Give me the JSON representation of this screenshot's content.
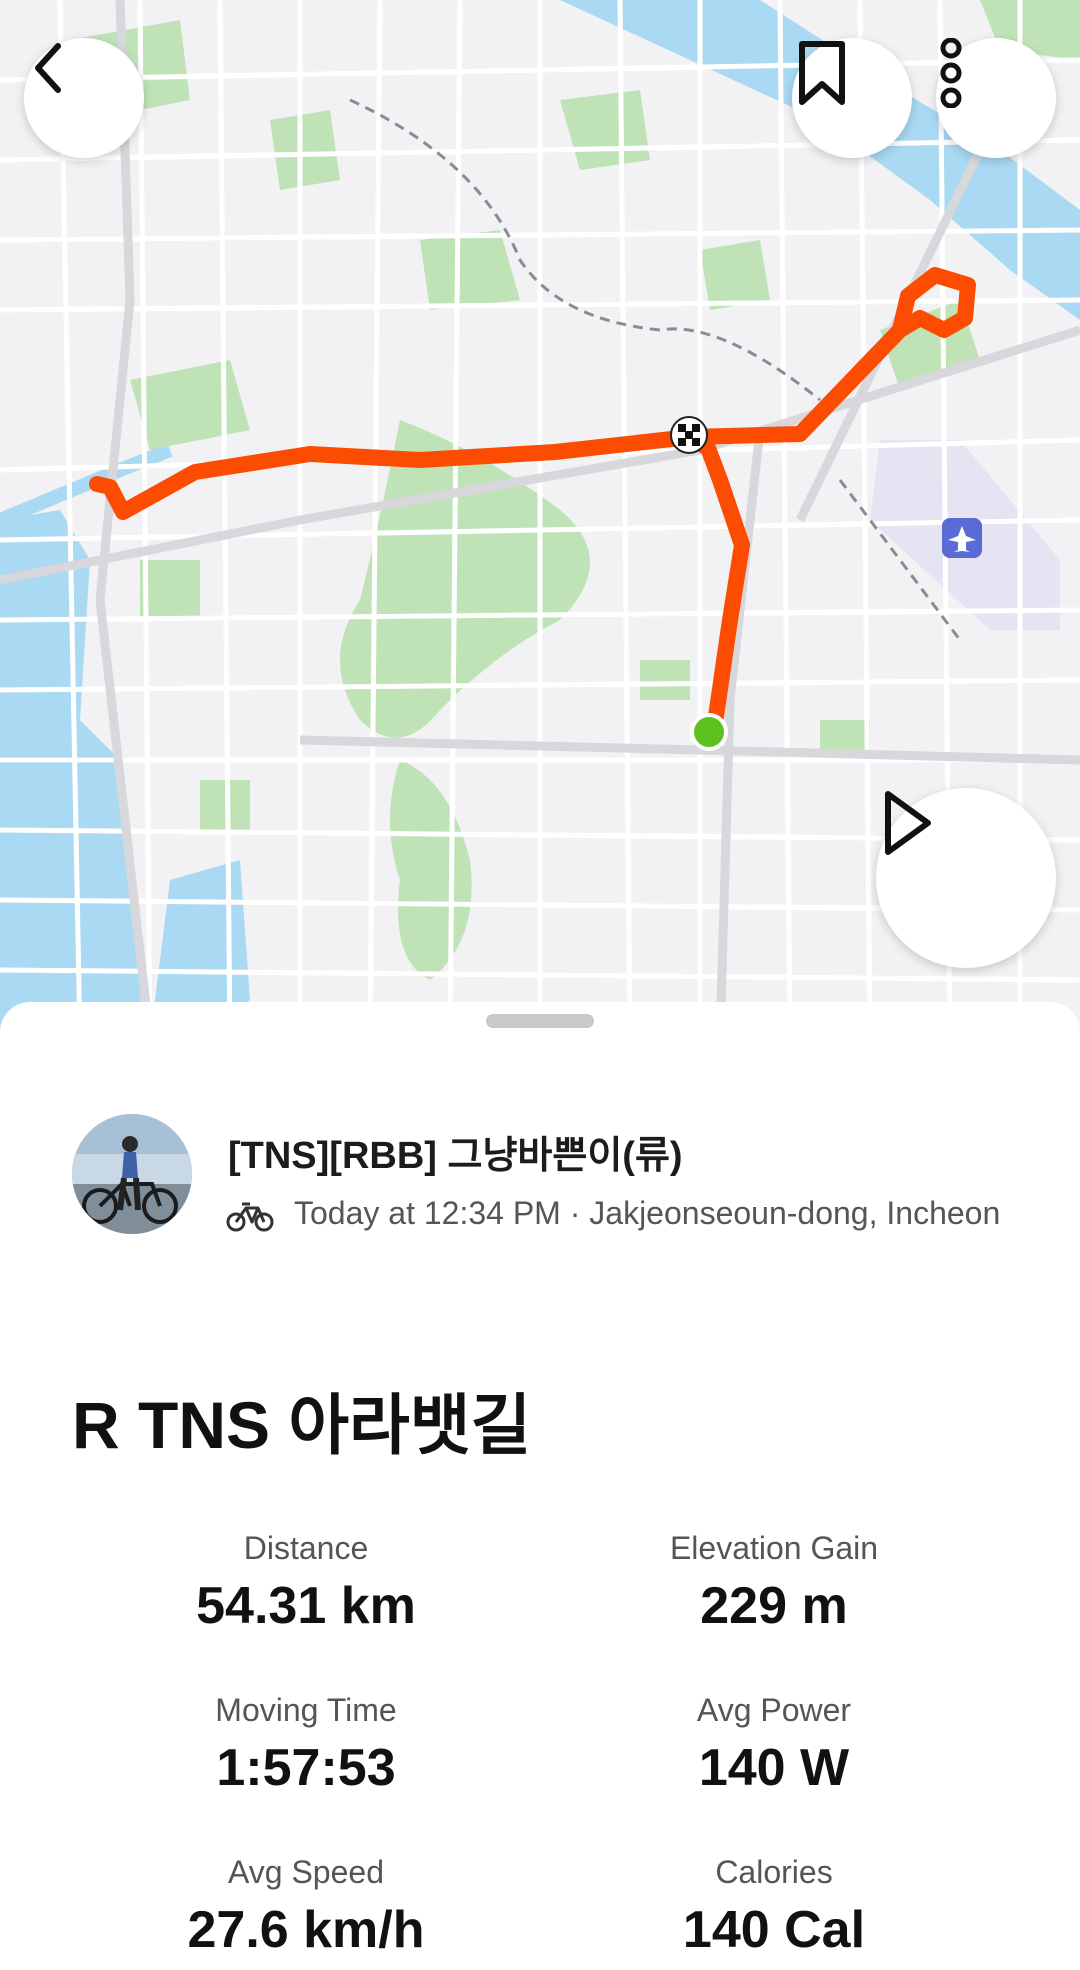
{
  "map": {
    "route_color": "#fc4c02",
    "start_marker_color": "#5dc21e",
    "icons": [
      "back-arrow-icon",
      "bookmark-icon",
      "more-vertical-icon",
      "play-icon",
      "airport-icon",
      "checkered-flag-icon"
    ]
  },
  "athlete": {
    "name": "[TNS][RBB] 그냥바쁜이(류)",
    "activity_meta": "Today at 12:34 PM · Jakjeonseoun-dong, Incheon",
    "activity_type_icon": "bike-icon"
  },
  "activity": {
    "title": "R TNS 아라뱃길"
  },
  "stats": {
    "distance": {
      "label": "Distance",
      "value": "54.31 km"
    },
    "elevation": {
      "label": "Elevation Gain",
      "value": "229 m"
    },
    "moving_time": {
      "label": "Moving Time",
      "value": "1:57:53"
    },
    "avg_power": {
      "label": "Avg Power",
      "value": "140 W"
    },
    "avg_speed": {
      "label": "Avg Speed",
      "value": "27.6 km/h"
    },
    "calories": {
      "label": "Calories",
      "value": "140 Cal"
    }
  }
}
